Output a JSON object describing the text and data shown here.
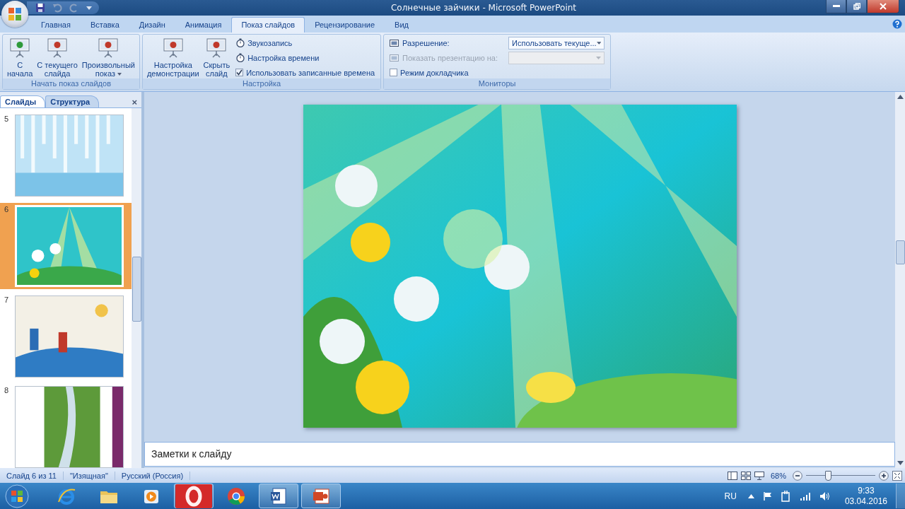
{
  "window": {
    "title": "Солнечные зайчики - Microsoft PowerPoint"
  },
  "ribbon_tabs": [
    {
      "label": "Главная",
      "selected": false
    },
    {
      "label": "Вставка",
      "selected": false
    },
    {
      "label": "Дизайн",
      "selected": false
    },
    {
      "label": "Анимация",
      "selected": false
    },
    {
      "label": "Показ слайдов",
      "selected": true
    },
    {
      "label": "Рецензирование",
      "selected": false
    },
    {
      "label": "Вид",
      "selected": false
    }
  ],
  "ribbon_groups": [
    {
      "label": "Начать показ слайдов",
      "big_buttons": [
        {
          "lines": [
            "С",
            "начала"
          ]
        },
        {
          "lines": [
            "С текущего",
            "слайда"
          ]
        },
        {
          "lines": [
            "Произвольный",
            "показ"
          ],
          "caret": true
        }
      ]
    },
    {
      "label": "Настройка",
      "big_buttons": [
        {
          "lines": [
            "Настройка",
            "демонстрации"
          ]
        },
        {
          "lines": [
            "Скрыть",
            "слайд"
          ]
        }
      ],
      "small_items": [
        {
          "kind": "button",
          "label": "Звукозапись",
          "disabled": false
        },
        {
          "kind": "button",
          "label": "Настройка времени",
          "disabled": false
        },
        {
          "kind": "checkbox",
          "label": "Использовать записанные времена",
          "checked": true
        }
      ]
    },
    {
      "label": "Мониторы",
      "small_items": [
        {
          "kind": "dropdown",
          "label": "Разрешение:",
          "value": "Использовать текуще...",
          "disabled": false
        },
        {
          "kind": "dropdown",
          "label": "Показать презентацию на:",
          "disabled": true
        },
        {
          "kind": "checkbox",
          "label": "Режим докладчика",
          "checked": false
        }
      ]
    }
  ],
  "panel_tabs": [
    {
      "label": "Слайды",
      "selected": true
    },
    {
      "label": "Структура",
      "selected": false
    }
  ],
  "panel_close": "×",
  "thumbnails": [
    {
      "number": "5",
      "selected": false
    },
    {
      "number": "6",
      "selected": true
    },
    {
      "number": "7",
      "selected": false
    },
    {
      "number": "8",
      "selected": false
    }
  ],
  "notes": {
    "placeholder": "Заметки к слайду"
  },
  "status_bar": {
    "fields": [
      "Слайд 6 из 11",
      "\"Изящная\"",
      "Русский (Россия)"
    ],
    "zoom": "68%",
    "level": 0.31
  },
  "taskbar": {
    "apps": [
      {
        "kind": "ie",
        "running": false
      },
      {
        "kind": "folder",
        "running": false
      },
      {
        "kind": "player",
        "running": false
      },
      {
        "kind": "opera",
        "running": true
      },
      {
        "kind": "chrome",
        "running": false
      },
      {
        "kind": "word",
        "running": true
      },
      {
        "kind": "powerpoint",
        "running": true
      }
    ],
    "language": "RU",
    "time": "9:33",
    "date": "03.04.2016"
  }
}
